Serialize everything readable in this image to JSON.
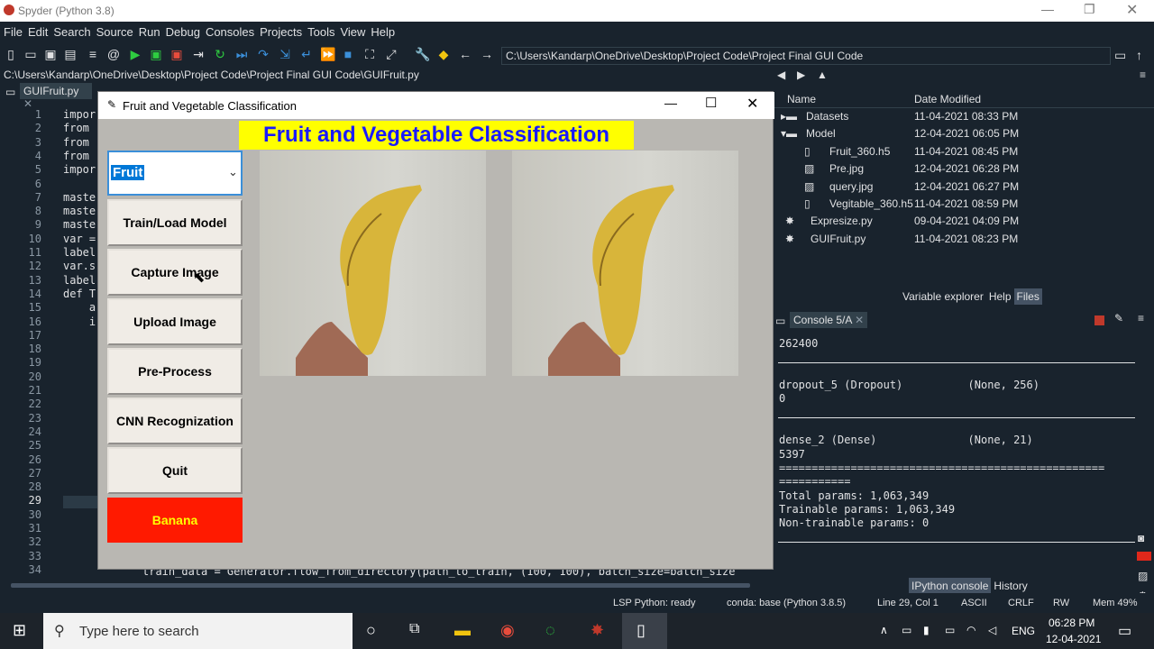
{
  "window": {
    "title": "Spyder (Python 3.8)"
  },
  "menu": [
    "File",
    "Edit",
    "Search",
    "Source",
    "Run",
    "Debug",
    "Consoles",
    "Projects",
    "Tools",
    "View",
    "Help"
  ],
  "toolbar": {
    "path": "C:\\Users\\Kandarp\\OneDrive\\Desktop\\Project Code\\Project Final GUI Code"
  },
  "editor": {
    "filepath": "C:\\Users\\Kandarp\\OneDrive\\Desktop\\Project Code\\Project Final GUI Code\\GUIFruit.py",
    "tab": "GUIFruit.py",
    "lines": [
      "1",
      "2",
      "3",
      "4",
      "5",
      "6",
      "7",
      "8",
      "9",
      "10",
      "11",
      "12",
      "13",
      "14",
      "15",
      "16",
      "17",
      "18",
      "19",
      "20",
      "21",
      "22",
      "23",
      "24",
      "25",
      "26",
      "27",
      "28",
      "29",
      "30",
      "31",
      "32",
      "33",
      "34"
    ],
    "code": [
      "impor",
      "from",
      "from",
      "from",
      "impor",
      "",
      "maste",
      "maste",
      "maste",
      "var =",
      "label",
      "var.s",
      "label",
      "def T",
      "    a",
      "    i"
    ],
    "bottom_line": "train_data = Generator.flow_from_directory(path_to_train, (100, 100), batch_size=batch_size"
  },
  "files": {
    "col_name": "Name",
    "col_date": "Date Modified",
    "items": [
      {
        "name": "Datasets",
        "date": "11-04-2021 08:33 PM"
      },
      {
        "name": "Model",
        "date": "12-04-2021 06:05 PM"
      },
      {
        "name": "Fruit_360.h5",
        "date": "11-04-2021 08:45 PM"
      },
      {
        "name": "Pre.jpg",
        "date": "12-04-2021 06:28 PM"
      },
      {
        "name": "query.jpg",
        "date": "12-04-2021 06:27 PM"
      },
      {
        "name": "Vegitable_360.h5",
        "date": "11-04-2021 08:59 PM"
      },
      {
        "name": "Expresize.py",
        "date": "09-04-2021 04:09 PM"
      },
      {
        "name": "GUIFruit.py",
        "date": "11-04-2021 08:23 PM"
      }
    ],
    "tabs": [
      "Variable explorer",
      "Help",
      "Files"
    ]
  },
  "console": {
    "tab": "Console 5/A",
    "lines": [
      "262400",
      "dropout_5 (Dropout)          (None, 256)",
      "0",
      "dense_2 (Dense)              (None, 21)",
      "5397",
      "==================================================",
      "===========",
      "Total params: 1,063,349",
      "Trainable params: 1,063,349",
      "Non-trainable params: 0"
    ],
    "tabs": [
      "IPython console",
      "History"
    ]
  },
  "status": {
    "lsp": "LSP Python: ready",
    "conda": "conda: base (Python 3.8.5)",
    "pos": "Line 29, Col 1",
    "enc": "ASCII",
    "eol": "CRLF",
    "rw": "RW",
    "mem": "Mem 49%"
  },
  "gui": {
    "title": "Fruit and Vegetable Classification",
    "heading": "Fruit and Vegetable Classification",
    "dropdown": "Fruit",
    "buttons": [
      "Train/Load Model",
      "Capture Image",
      "Upload Image",
      "Pre-Process",
      "CNN Recognization",
      "Quit"
    ],
    "result": "Banana"
  },
  "taskbar": {
    "search": "Type here to search",
    "lang": "ENG",
    "time": "06:28 PM",
    "date": "12-04-2021"
  },
  "colors": {
    "accent": "#ffff00",
    "heading": "#1a1aff",
    "result_bg": "#ff1a00"
  }
}
